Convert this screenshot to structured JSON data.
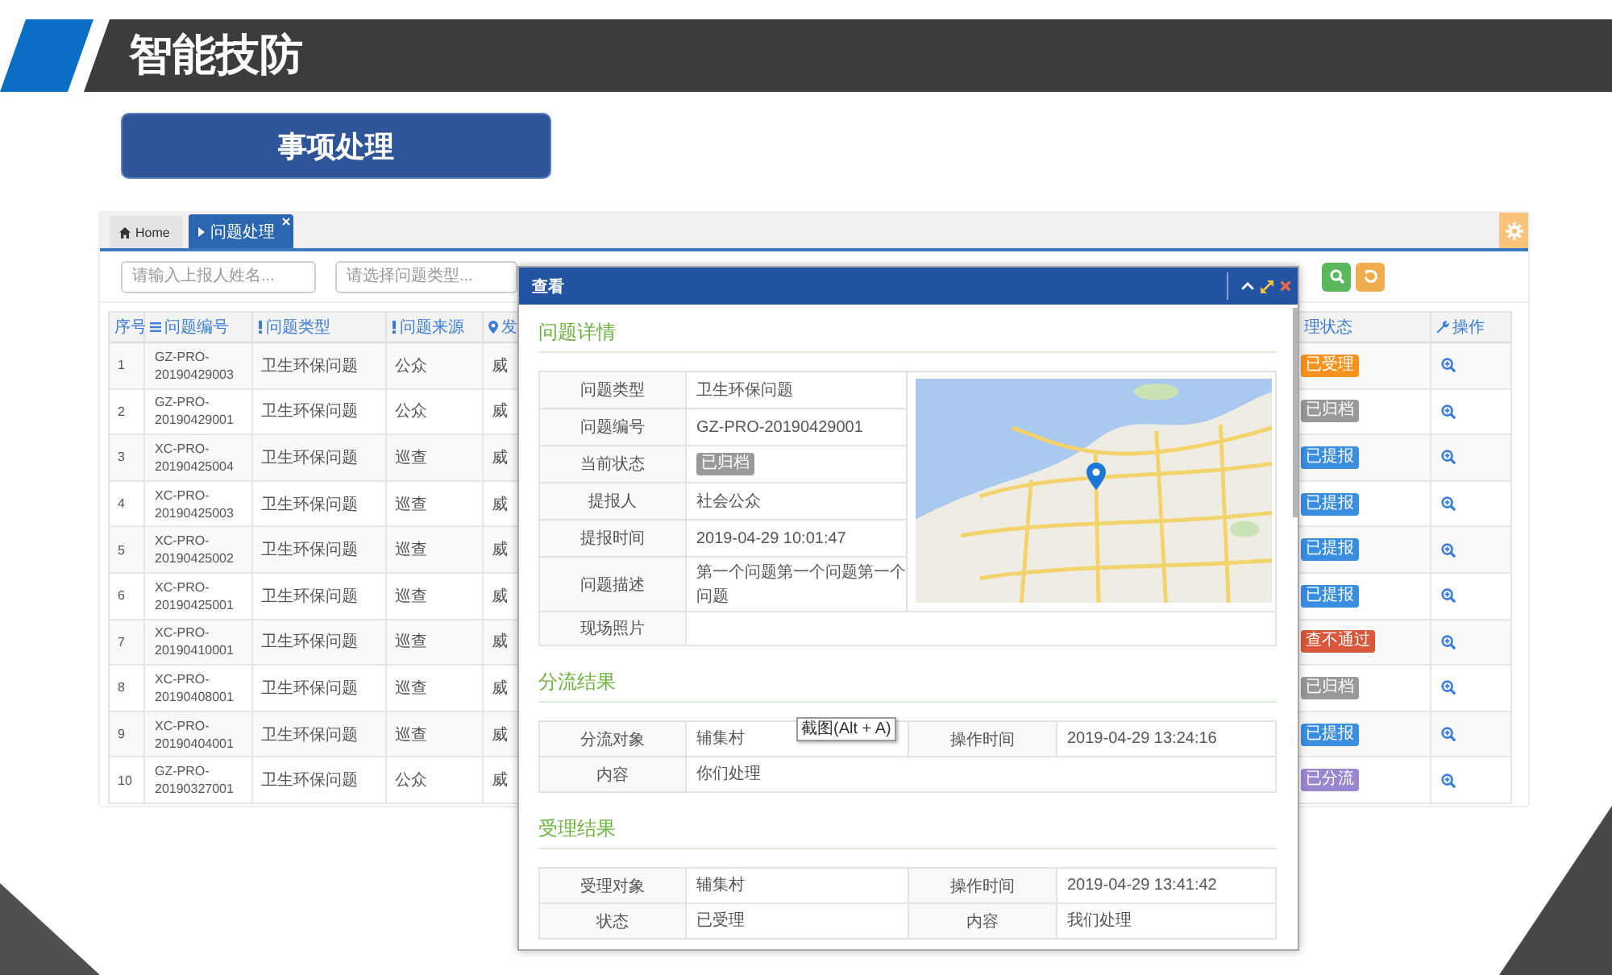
{
  "slide": {
    "title": "智能技防",
    "banner": "事项处理"
  },
  "app": {
    "tabs": [
      {
        "label": "Home",
        "selected": false
      },
      {
        "label": "问题处理",
        "selected": true
      }
    ],
    "filters": [
      {
        "placeholder": "请输入上报人姓名..."
      },
      {
        "placeholder": "请选择问题类型..."
      }
    ],
    "table": {
      "columns": [
        {
          "label": "序号"
        },
        {
          "label": "问题编号"
        },
        {
          "label": "问题类型"
        },
        {
          "label": "问题来源"
        },
        {
          "label": "发"
        },
        {
          "label": "理状态"
        },
        {
          "label": "操作"
        }
      ],
      "rows": [
        {
          "no": "1",
          "code": "GZ-PRO-20190429003",
          "type": "卫生环保问题",
          "source": "公众",
          "place": "威",
          "status": {
            "label": "已受理",
            "color": "#f7931e"
          }
        },
        {
          "no": "2",
          "code": "GZ-PRO-20190429001",
          "type": "卫生环保问题",
          "source": "公众",
          "place": "威",
          "status": {
            "label": "已归档",
            "color": "#999999"
          }
        },
        {
          "no": "3",
          "code": "XC-PRO-20190425004",
          "type": "卫生环保问题",
          "source": "巡查",
          "place": "威",
          "status": {
            "label": "已提报",
            "color": "#3a8ee0"
          }
        },
        {
          "no": "4",
          "code": "XC-PRO-20190425003",
          "type": "卫生环保问题",
          "source": "巡查",
          "place": "威",
          "status": {
            "label": "已提报",
            "color": "#3a8ee0"
          }
        },
        {
          "no": "5",
          "code": "XC-PRO-20190425002",
          "type": "卫生环保问题",
          "source": "巡查",
          "place": "威",
          "status": {
            "label": "已提报",
            "color": "#3a8ee0"
          }
        },
        {
          "no": "6",
          "code": "XC-PRO-20190425001",
          "type": "卫生环保问题",
          "source": "巡查",
          "place": "威",
          "status": {
            "label": "已提报",
            "color": "#3a8ee0"
          }
        },
        {
          "no": "7",
          "code": "XC-PRO-20190410001",
          "type": "卫生环保问题",
          "source": "巡查",
          "place": "威",
          "status": {
            "label": "查不通过",
            "color": "#d9583b"
          }
        },
        {
          "no": "8",
          "code": "XC-PRO-20190408001",
          "type": "卫生环保问题",
          "source": "巡查",
          "place": "威",
          "status": {
            "label": "已归档",
            "color": "#999999"
          }
        },
        {
          "no": "9",
          "code": "XC-PRO-20190404001",
          "type": "卫生环保问题",
          "source": "巡查",
          "place": "威",
          "status": {
            "label": "已提报",
            "color": "#3a8ee0"
          }
        },
        {
          "no": "10",
          "code": "GZ-PRO-20190327001",
          "type": "卫生环保问题",
          "source": "公众",
          "place": "威",
          "status": {
            "label": "已分流",
            "color": "#9a86cf"
          }
        }
      ]
    }
  },
  "dialog": {
    "title": "查看",
    "details": {
      "heading": "问题详情",
      "fields": [
        {
          "label": "问题类型",
          "value": "卫生环保问题",
          "kind": "text"
        },
        {
          "label": "问题编号",
          "value": "GZ-PRO-20190429001",
          "kind": "text"
        },
        {
          "label": "当前状态",
          "value": "已归档",
          "kind": "badge"
        },
        {
          "label": "提报人",
          "value": "社会公众",
          "kind": "text"
        },
        {
          "label": "提报时间",
          "value": "2019-04-29 10:01:47",
          "kind": "text"
        },
        {
          "label": "问题描述",
          "value": "第一个问题第一个问题第一个问题",
          "kind": "text"
        }
      ],
      "photo_label": "现场照片"
    },
    "results": [
      {
        "heading": "分流结果",
        "rows": [
          {
            "pairs": [
              {
                "label": "分流对象",
                "value": "辅集村"
              },
              {
                "label": "操作时间",
                "value": "2019-04-29 13:24:16"
              }
            ]
          },
          {
            "pairs": [
              {
                "label": "内容",
                "value": "你们处理"
              }
            ]
          }
        ]
      },
      {
        "heading": "受理结果",
        "rows": [
          {
            "pairs": [
              {
                "label": "受理对象",
                "value": "辅集村"
              },
              {
                "label": "操作时间",
                "value": "2019-04-29 13:41:42"
              }
            ]
          },
          {
            "pairs": [
              {
                "label": "状态",
                "value": "已受理"
              },
              {
                "label": "内容",
                "value": "我们处理"
              }
            ]
          }
        ]
      }
    ],
    "tooltip": "截图(Alt + A)"
  }
}
